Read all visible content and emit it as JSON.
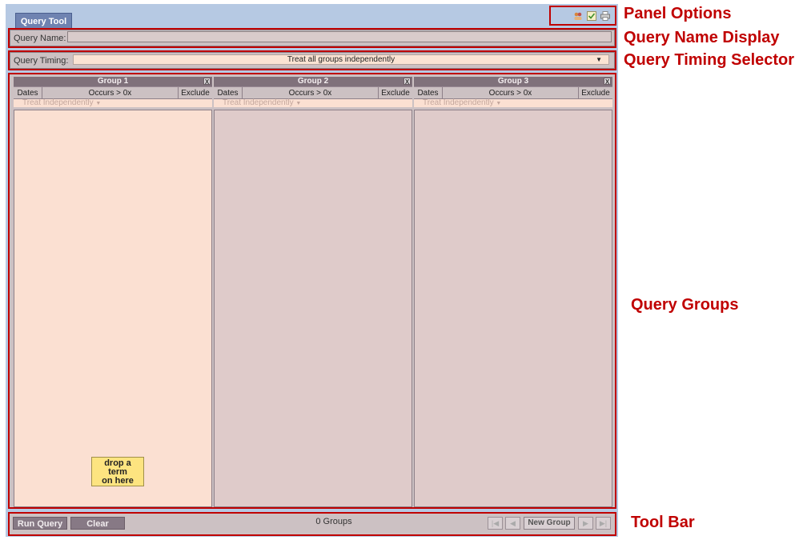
{
  "tab": {
    "label": "Query Tool"
  },
  "panel_options": {
    "icons": [
      "people-icon",
      "check-icon",
      "printer-icon"
    ]
  },
  "query_name": {
    "label": "Query Name:",
    "value": ""
  },
  "query_timing": {
    "label": "Query Timing:",
    "value": "Treat all groups independently"
  },
  "groups": [
    {
      "title": "Group 1",
      "dates": "Dates",
      "occurs": "Occurs > 0x",
      "exclude": "Exclude",
      "treat": "Treat Independently",
      "close": "X"
    },
    {
      "title": "Group 2",
      "dates": "Dates",
      "occurs": "Occurs > 0x",
      "exclude": "Exclude",
      "treat": "Treat Independently",
      "close": "X"
    },
    {
      "title": "Group 3",
      "dates": "Dates",
      "occurs": "Occurs > 0x",
      "exclude": "Exclude",
      "treat": "Treat Independently",
      "close": "X"
    }
  ],
  "drop_note": {
    "line1": "drop a",
    "line2": "term",
    "line3": "on here"
  },
  "toolbar": {
    "run_query": "Run Query",
    "clear": "Clear",
    "groups_count": "0 Groups",
    "new_group": "New Group"
  },
  "annotations": {
    "panel_options": "Panel Options",
    "query_name_display": "Query Name Display",
    "query_timing_selector": "Query Timing Selector",
    "query_groups": "Query Groups",
    "tool_bar": "Tool Bar"
  },
  "colors": {
    "annotation": "#c00000",
    "tab": "#6f83b1",
    "group1_bg": "#fbe0d2",
    "group_bg": "#dfcbca"
  }
}
